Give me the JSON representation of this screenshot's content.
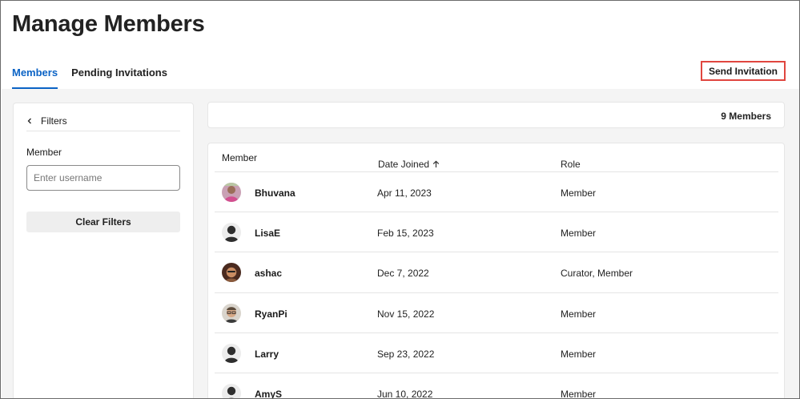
{
  "page": {
    "title": "Manage Members"
  },
  "tabs": [
    {
      "label": "Members",
      "active": true
    },
    {
      "label": "Pending Invitations",
      "active": false
    }
  ],
  "actions": {
    "send_invitation": "Send Invitation"
  },
  "filters": {
    "header": "Filters",
    "member_label": "Member",
    "username_placeholder": "Enter username",
    "username_value": "",
    "clear_label": "Clear Filters"
  },
  "summary": {
    "count_text": "9 Members"
  },
  "table": {
    "columns": {
      "member": "Member",
      "date_joined": "Date Joined",
      "role": "Role"
    },
    "sort": {
      "column": "date_joined",
      "direction": "ascending-arrow"
    },
    "rows": [
      {
        "name": "Bhuvana",
        "date": "Apr 11, 2023",
        "role": "Member",
        "avatar": "photo-pink"
      },
      {
        "name": "LisaE",
        "date": "Feb 15, 2023",
        "role": "Member",
        "avatar": "default-silhouette"
      },
      {
        "name": "ashac",
        "date": "Dec 7, 2022",
        "role": "Curator, Member",
        "avatar": "photo-brown"
      },
      {
        "name": "RyanPi",
        "date": "Nov 15, 2022",
        "role": "Member",
        "avatar": "photo-glasses"
      },
      {
        "name": "Larry",
        "date": "Sep 23, 2022",
        "role": "Member",
        "avatar": "default-silhouette"
      },
      {
        "name": "AmyS",
        "date": "Jun 10, 2022",
        "role": "Member",
        "avatar": "default-silhouette"
      }
    ]
  },
  "colors": {
    "accent": "#0b63c5",
    "highlight_border": "#e0463f",
    "background": "#f4f4f4"
  }
}
